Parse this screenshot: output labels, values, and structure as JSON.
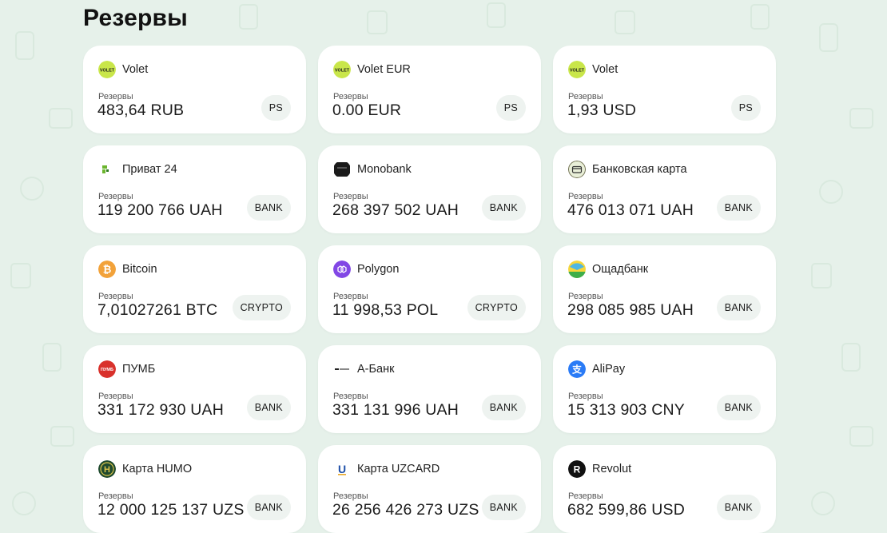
{
  "page": {
    "title": "Резервы"
  },
  "colors": {
    "background": "#e6f1ea",
    "card": "#ffffff",
    "badge": "#eef3f0"
  },
  "reserves": [
    {
      "name": "Volet",
      "label": "Резервы",
      "amount": "483,64 RUB",
      "badge": "PS",
      "icon": "volet-icon",
      "icon_color": "#c9e64a",
      "icon_text": "VOLET"
    },
    {
      "name": "Volet EUR",
      "label": "Резервы",
      "amount": "0.00 EUR",
      "badge": "PS",
      "icon": "volet-icon",
      "icon_color": "#c9e64a",
      "icon_text": "VOLET"
    },
    {
      "name": "Volet",
      "label": "Резервы",
      "amount": "1,93 USD",
      "badge": "PS",
      "icon": "volet-icon",
      "icon_color": "#c9e64a",
      "icon_text": "VOLET"
    },
    {
      "name": "Приват 24",
      "label": "Резервы",
      "amount": "119 200 766 UAH",
      "badge": "BANK",
      "icon": "privat24-icon",
      "icon_color": "#6bb52e",
      "icon_text": ""
    },
    {
      "name": "Monobank",
      "label": "Резервы",
      "amount": "268 397 502 UAH",
      "badge": "BANK",
      "icon": "monobank-icon",
      "icon_color": "#1a1a1a",
      "icon_text": ""
    },
    {
      "name": "Банковская карта",
      "label": "Резервы",
      "amount": "476 013 071 UAH",
      "badge": "BANK",
      "icon": "bank-card-icon",
      "icon_color": "#e9efd8",
      "icon_text": ""
    },
    {
      "name": "Bitcoin",
      "label": "Резервы",
      "amount": "7,01027261 BTC",
      "badge": "CRYPTO",
      "icon": "bitcoin-icon",
      "icon_color": "#f2a23a",
      "icon_text": "₿"
    },
    {
      "name": "Polygon",
      "label": "Резервы",
      "amount": "11 998,53 POL",
      "badge": "CRYPTO",
      "icon": "polygon-icon",
      "icon_color": "#8247e5",
      "icon_text": ""
    },
    {
      "name": "Ощадбанк",
      "label": "Резервы",
      "amount": "298 085 985 UAH",
      "badge": "BANK",
      "icon": "oschadbank-icon",
      "icon_color": "#3fae4a",
      "icon_text": ""
    },
    {
      "name": "ПУМБ",
      "label": "Резервы",
      "amount": "331 172 930 UAH",
      "badge": "BANK",
      "icon": "pumb-icon",
      "icon_color": "#d9312b",
      "icon_text": "ПУМБ"
    },
    {
      "name": "А-Банк",
      "label": "Резервы",
      "amount": "331 131 996 UAH",
      "badge": "BANK",
      "icon": "abank-icon",
      "icon_color": "#ffffff",
      "icon_text": ""
    },
    {
      "name": "AliPay",
      "label": "Резервы",
      "amount": "15 313 903 CNY",
      "badge": "BANK",
      "icon": "alipay-icon",
      "icon_color": "#2a7bf6",
      "icon_text": "支"
    },
    {
      "name": "Карта HUMO",
      "label": "Резервы",
      "amount": "12 000 125 137 UZS",
      "badge": "BANK",
      "icon": "humo-icon",
      "icon_color": "#1f4a2e",
      "icon_text": "H"
    },
    {
      "name": "Карта UZCARD",
      "label": "Резервы",
      "amount": "26 256 426 273 UZS",
      "badge": "BANK",
      "icon": "uzcard-icon",
      "icon_color": "#ffffff",
      "icon_text": "U"
    },
    {
      "name": "Revolut",
      "label": "Резервы",
      "amount": "682 599,86 USD",
      "badge": "BANK",
      "icon": "revolut-icon",
      "icon_color": "#111111",
      "icon_text": "R"
    }
  ]
}
